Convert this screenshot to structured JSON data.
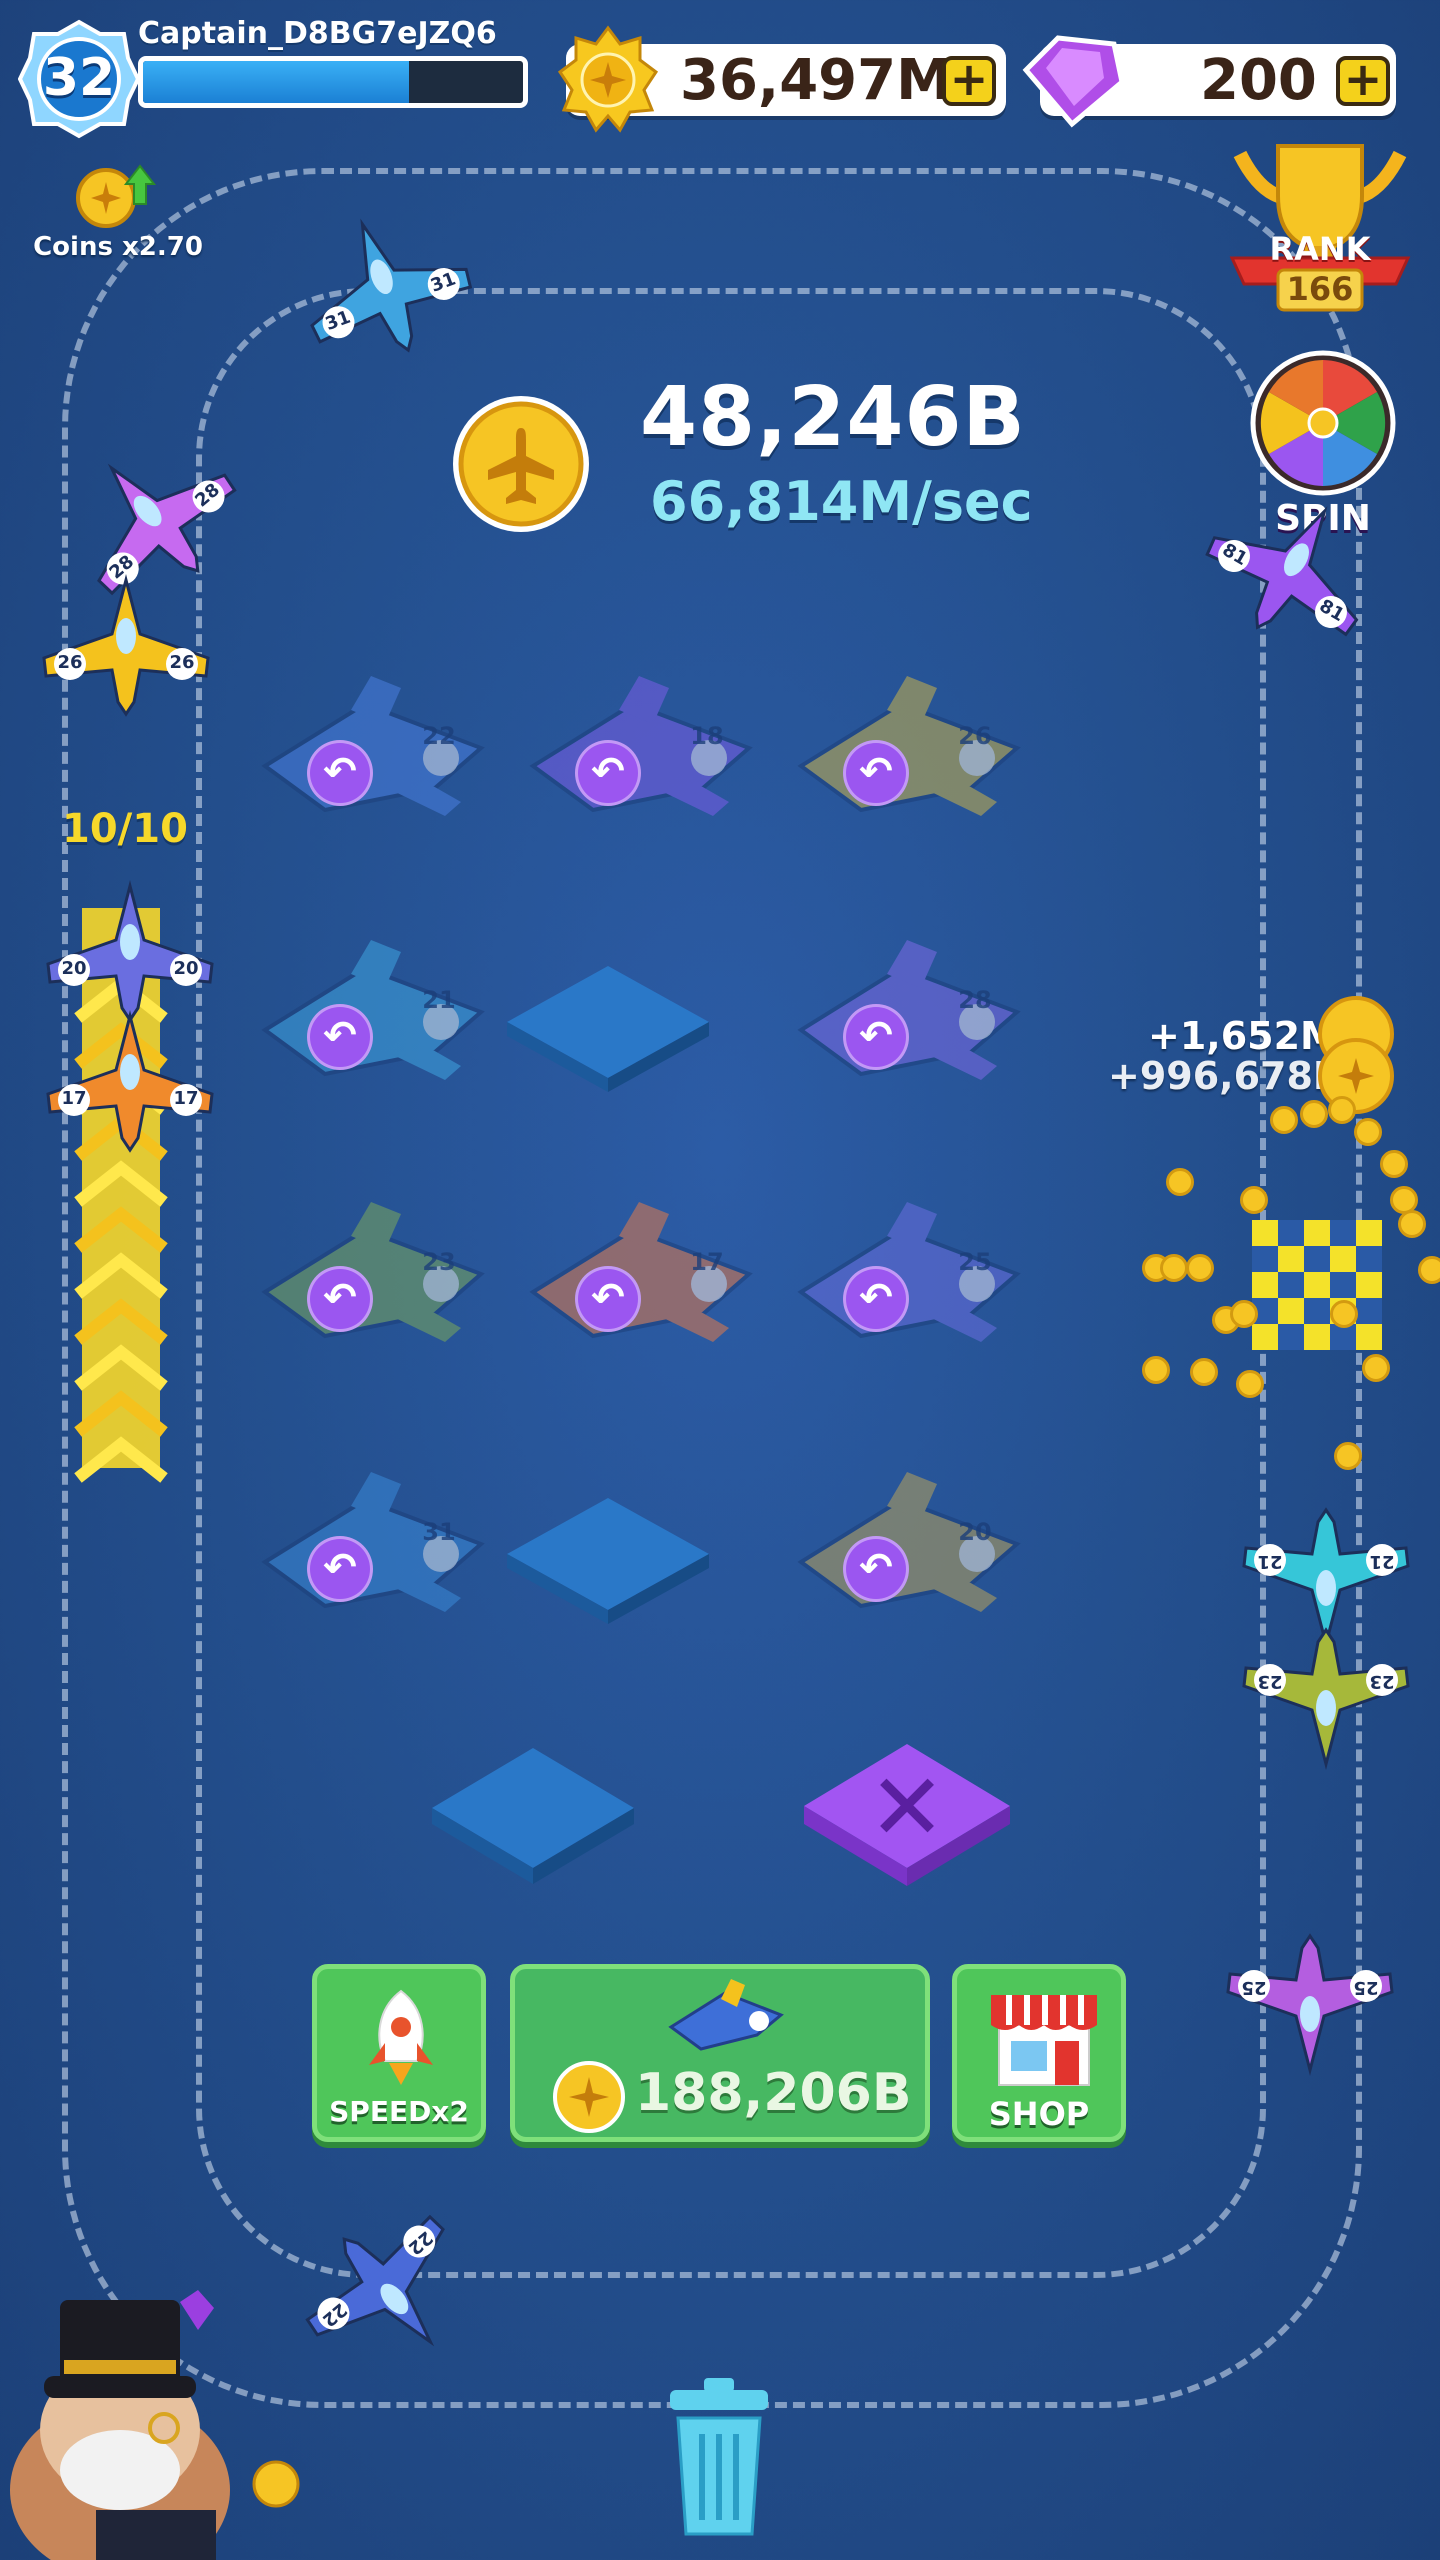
{
  "player": {
    "level": "32",
    "name": "Captain_D8BG7eJZQ6",
    "xp_progress": 0.7
  },
  "currency": {
    "coins": "36,497M",
    "gems": "200",
    "plus": "+"
  },
  "boost": {
    "label": "Coins x2.70"
  },
  "balance": {
    "total": "48,246B",
    "rate": "66,814M/sec"
  },
  "rank": {
    "label": "RANK",
    "value": "166"
  },
  "spin": {
    "label": "SPIN"
  },
  "launch": {
    "counter": "10/10"
  },
  "grid": {
    "rows": [
      [
        {
          "level": "22",
          "state": "sent"
        },
        {
          "level": "18",
          "state": "sent"
        },
        {
          "level": "26",
          "state": "sent"
        }
      ],
      [
        {
          "level": "21",
          "state": "sent"
        },
        {
          "level": "",
          "state": "empty"
        },
        {
          "level": "28",
          "state": "sent"
        }
      ],
      [
        {
          "level": "23",
          "state": "sent"
        },
        {
          "level": "17",
          "state": "sent"
        },
        {
          "level": "25",
          "state": "sent"
        }
      ],
      [
        {
          "level": "31",
          "state": "sent"
        },
        {
          "level": "",
          "state": "empty"
        },
        {
          "level": "20",
          "state": "sent"
        }
      ]
    ]
  },
  "track_planes": [
    "31",
    "28",
    "26",
    "20",
    "17",
    "81",
    "21",
    "23",
    "25",
    "22"
  ],
  "floating_income": [
    "+1,652M",
    "+996,678K"
  ],
  "buttons": {
    "speed": "SPEEDx2",
    "buy_cost": "188,206B",
    "shop": "SHOP",
    "cancel": "✕"
  },
  "colors": {
    "background": "#24508f",
    "accent_purple": "#9b56f0",
    "green": "#4fc65a",
    "gold": "#f4c21d",
    "xp_blue": "#2a95e6"
  }
}
